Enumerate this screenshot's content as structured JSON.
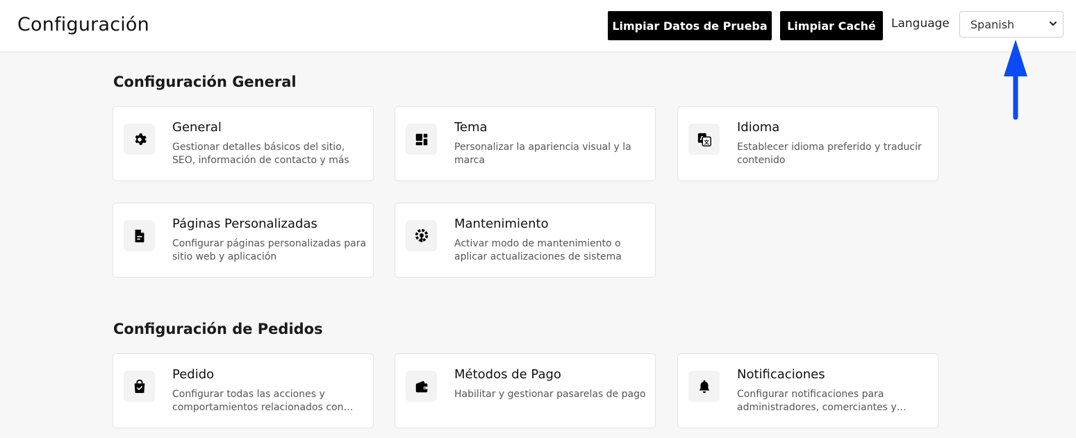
{
  "header": {
    "title": "Configuración",
    "clear_test_data_label": "Limpiar Datos de Prueba",
    "clear_cache_label": "Limpiar Caché",
    "language_label": "Language",
    "language_selected": "Spanish"
  },
  "annotation": {
    "arrow_color": "#0b4bf5",
    "icon": "arrow-up-icon"
  },
  "sections": [
    {
      "title": "Configuración General",
      "cards": [
        {
          "title": "General",
          "description": "Gestionar detalles básicos del sitio, SEO, información de contacto y más",
          "icon": "gear-icon"
        },
        {
          "title": "Tema",
          "description": "Personalizar la apariencia visual y la marca",
          "icon": "layout-icon"
        },
        {
          "title": "Idioma",
          "description": "Establecer idioma preferido y traducir contenido",
          "icon": "translate-icon"
        },
        {
          "title": "Páginas Personalizadas",
          "description": "Configurar páginas personalizadas para sitio web y aplicación",
          "icon": "file-icon"
        },
        {
          "title": "Mantenimiento",
          "description": "Activar modo de mantenimiento o aplicar actualizaciones de sistema",
          "icon": "maintenance-icon"
        }
      ]
    },
    {
      "title": "Configuración de Pedidos",
      "cards": [
        {
          "title": "Pedido",
          "description": "Configurar todas las acciones y comportamientos relacionados con pedidos",
          "icon": "shopping-bag-icon"
        },
        {
          "title": "Métodos de Pago",
          "description": "Habilitar y gestionar pasarelas de pago",
          "icon": "wallet-icon"
        },
        {
          "title": "Notificaciones",
          "description": "Configurar notificaciones para administradores, comerciantes y clientes",
          "icon": "bell-icon"
        }
      ]
    }
  ]
}
